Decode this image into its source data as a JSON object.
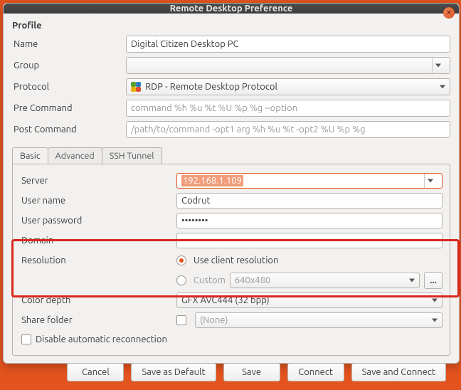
{
  "window_title": "Remote Desktop Preference",
  "sections": {
    "profile": "Profile"
  },
  "labels": {
    "name": "Name",
    "group": "Group",
    "protocol": "Protocol",
    "pre_command": "Pre Command",
    "post_command": "Post Command",
    "server": "Server",
    "user_name": "User name",
    "user_password": "User password",
    "domain": "Domain",
    "resolution": "Resolution",
    "color_depth": "Color depth",
    "share_folder": "Share folder",
    "disable_reconnect": "Disable automatic reconnection"
  },
  "values": {
    "name": "Digital Citizen Desktop PC",
    "group": "",
    "protocol": "RDP - Remote Desktop Protocol",
    "pre_command_placeholder": "command %h %u %t %U %p %g --option",
    "post_command_placeholder": "/path/to/command -opt1 arg %h %u %t -opt2 %U %p %g",
    "server": "192.168.1.109",
    "user_name": "Codrut",
    "user_password": "••••••••",
    "domain": "",
    "res_option1": "Use client resolution",
    "res_option2": "Custom",
    "res_custom": "640x480",
    "color_depth": "GFX AVC444 (32 bpp)",
    "share_folder": "(None)",
    "ellipsis": "..."
  },
  "tabs": {
    "basic": "Basic",
    "advanced": "Advanced",
    "ssh": "SSH Tunnel"
  },
  "buttons": {
    "cancel": "Cancel",
    "save_default": "Save as Default",
    "save": "Save",
    "connect": "Connect",
    "save_connect": "Save and Connect"
  }
}
